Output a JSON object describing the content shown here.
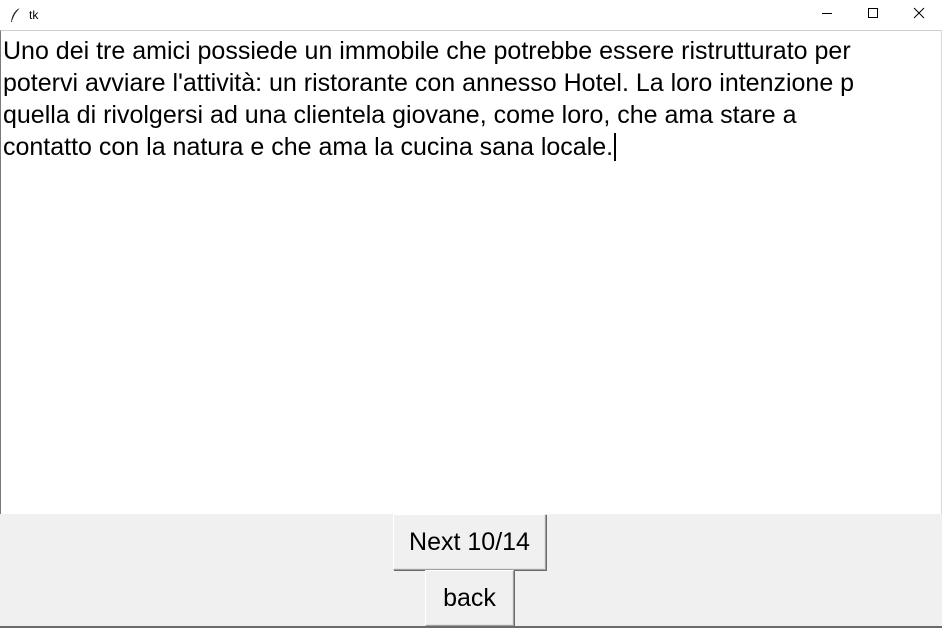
{
  "window": {
    "title": "tk",
    "icons": {
      "app": "feather-icon",
      "minimize": "minimize-icon",
      "maximize": "maximize-icon",
      "close": "close-icon"
    }
  },
  "text_editor": {
    "lines": [
      "Uno dei tre amici possiede un immobile che potrebbe essere ristrutturato per",
      "potervi avviare l'attività: un ristorante con annesso Hotel. La loro intenzione p",
      "quella di rivolgersi ad una clientela giovane, come loro, che ama stare a",
      "contatto con la natura e che ama la cucina sana locale."
    ]
  },
  "buttons": {
    "next_label": "Next 10/14",
    "back_label": "back"
  }
}
